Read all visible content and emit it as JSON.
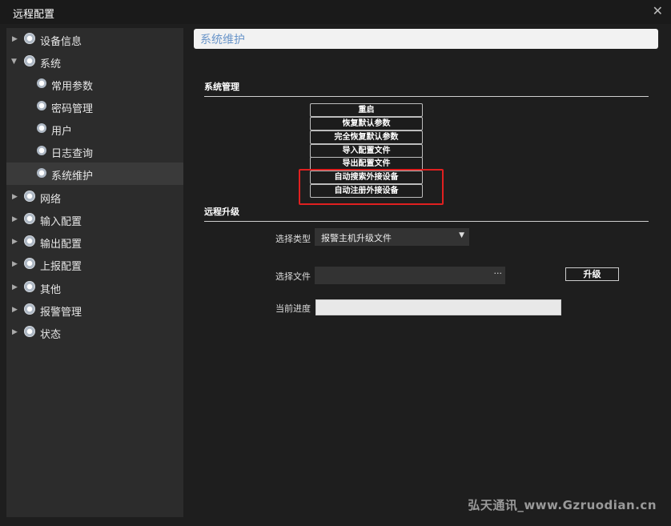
{
  "window": {
    "title": "远程配置",
    "close_icon": "close-icon"
  },
  "sidebar": {
    "items": [
      {
        "label": "设备信息",
        "level": 0,
        "expanded": false,
        "selected": false
      },
      {
        "label": "系统",
        "level": 0,
        "expanded": true,
        "selected": false
      },
      {
        "label": "常用参数",
        "level": 1,
        "selected": false
      },
      {
        "label": "密码管理",
        "level": 1,
        "selected": false
      },
      {
        "label": "用户",
        "level": 1,
        "selected": false
      },
      {
        "label": "日志查询",
        "level": 1,
        "selected": false
      },
      {
        "label": "系统维护",
        "level": 1,
        "selected": true
      },
      {
        "label": "网络",
        "level": 0,
        "expanded": false,
        "selected": false
      },
      {
        "label": "输入配置",
        "level": 0,
        "expanded": false,
        "selected": false
      },
      {
        "label": "输出配置",
        "level": 0,
        "expanded": false,
        "selected": false
      },
      {
        "label": "上报配置",
        "level": 0,
        "expanded": false,
        "selected": false
      },
      {
        "label": "其他",
        "level": 0,
        "expanded": false,
        "selected": false
      },
      {
        "label": "报警管理",
        "level": 0,
        "expanded": false,
        "selected": false
      },
      {
        "label": "状态",
        "level": 0,
        "expanded": false,
        "selected": false
      }
    ]
  },
  "main": {
    "header_title": "系统维护",
    "system_management": {
      "title": "系统管理",
      "buttons": [
        "重启",
        "恢复默认参数",
        "完全恢复默认参数",
        "导入配置文件",
        "导出配置文件",
        "自动搜索外接设备",
        "自动注册外接设备"
      ]
    },
    "remote_upgrade": {
      "title": "远程升级",
      "type_label": "选择类型",
      "type_value": "报警主机升级文件",
      "file_label": "选择文件",
      "file_value": "",
      "browse_label": "···",
      "upgrade_button": "升级",
      "progress_label": "当前进度",
      "progress_value": 0
    }
  },
  "watermark": "弘天通讯_www.Gzruodian.cn",
  "colors": {
    "accent_title": "#6a95c9",
    "highlight": "#e02020",
    "selected_bg": "#3a3a3a"
  }
}
